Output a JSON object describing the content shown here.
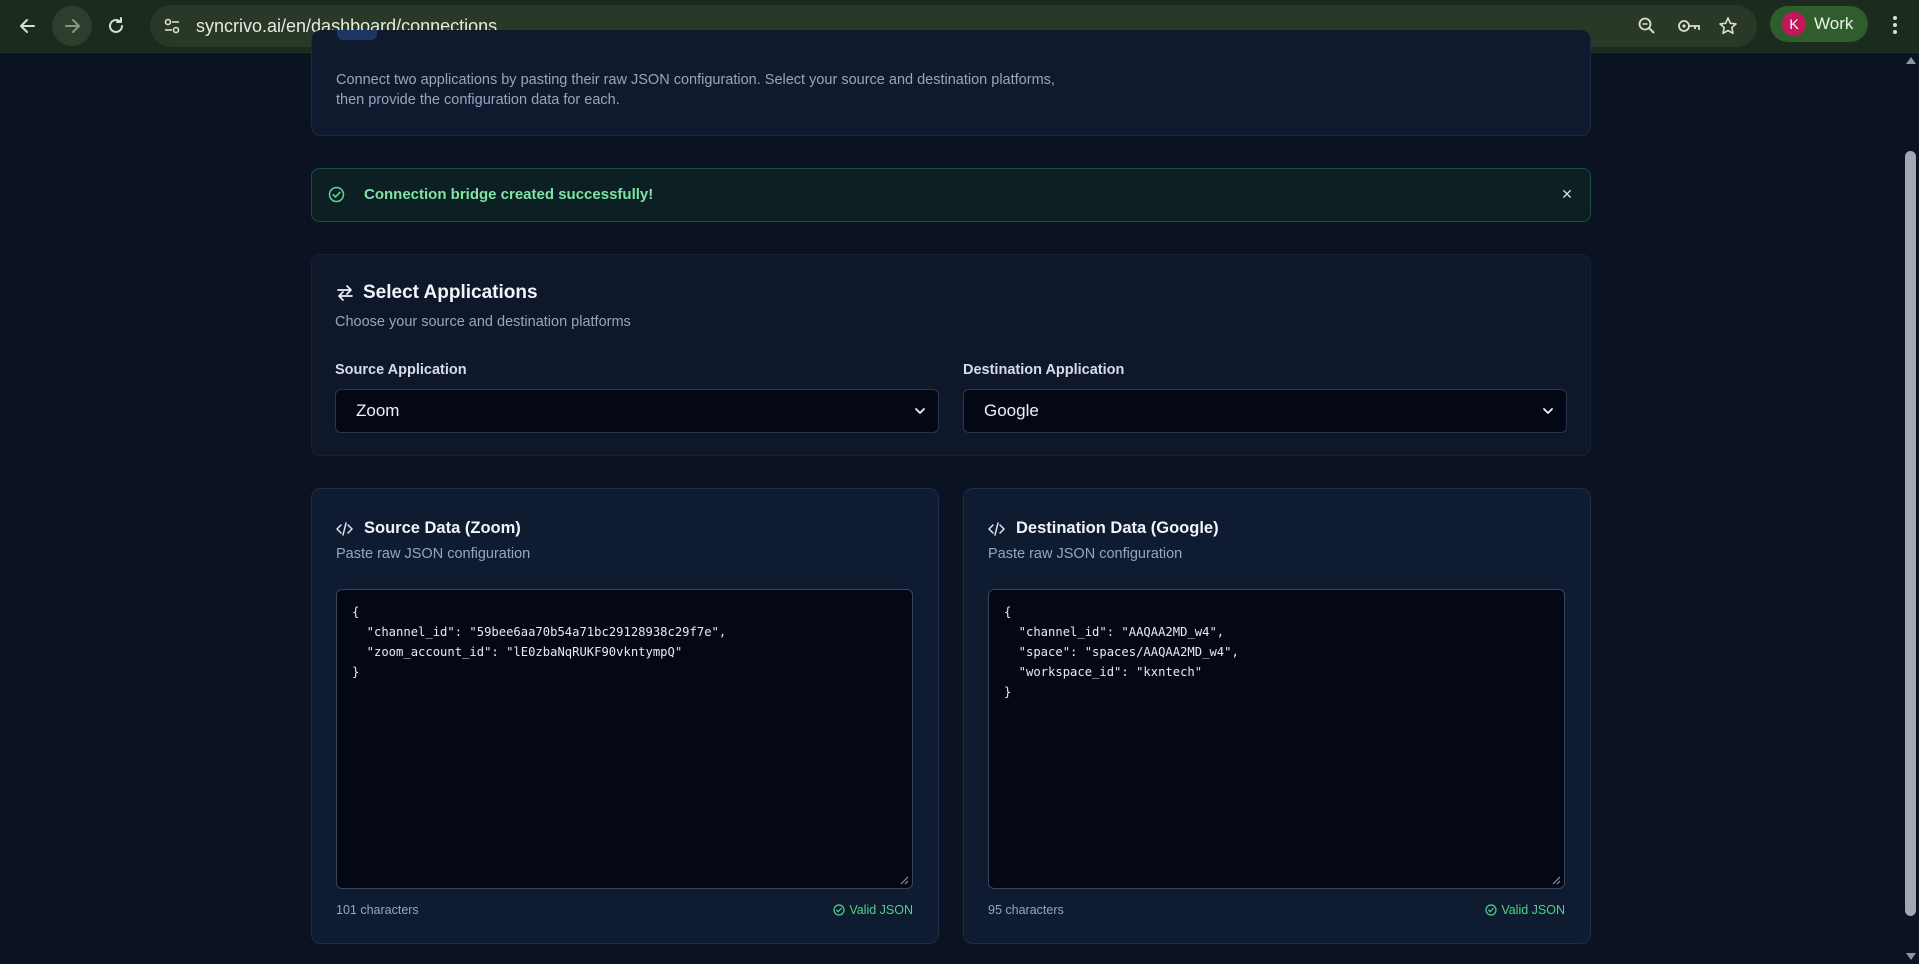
{
  "browser": {
    "url": "syncrivo.ai/en/dashboard/connections",
    "profile_initial": "K",
    "profile_name": "Work"
  },
  "header": {
    "description_line1": "Connect two applications by pasting their raw JSON configuration. Select your source and destination platforms,",
    "description_line2": "then provide the configuration data for each."
  },
  "alert": {
    "message": "Connection bridge created successfully!",
    "close_label": "✕"
  },
  "select_apps": {
    "title": "Select Applications",
    "subtitle": "Choose your source and destination platforms",
    "source_label": "Source Application",
    "source_value": "Zoom",
    "destination_label": "Destination Application",
    "destination_value": "Google"
  },
  "source_data": {
    "title": "Source Data (Zoom)",
    "subtitle": "Paste raw JSON configuration",
    "json": "{\n  \"channel_id\": \"59bee6aa70b54a71bc29128938c29f7e\",\n  \"zoom_account_id\": \"lE0zbaNqRUKF90vkntympQ\"\n}",
    "char_count": "101 characters",
    "status": "Valid JSON"
  },
  "destination_data": {
    "title": "Destination Data (Google)",
    "subtitle": "Paste raw JSON configuration",
    "json": "{\n  \"channel_id\": \"AAQAA2MD_w4\",\n  \"space\": \"spaces/AAQAA2MD_w4\",\n  \"workspace_id\": \"kxntech\"\n}",
    "char_count": "95 characters",
    "status": "Valid JSON"
  },
  "colors": {
    "page_bg": "#0b1222",
    "success": "#4fd28a",
    "chrome_bg": "#1b2b1d"
  }
}
